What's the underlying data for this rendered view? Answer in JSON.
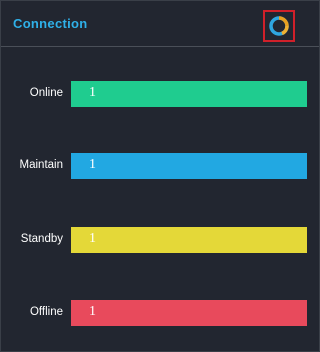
{
  "header": {
    "title": "Connection",
    "refresh_icon": "donut-refresh-icon",
    "refresh_colors": [
      "#2fa6e0",
      "#e8a020"
    ]
  },
  "rows": [
    {
      "label": "Online",
      "value": "1",
      "color": "#1fcc8f"
    },
    {
      "label": "Maintain",
      "value": "1",
      "color": "#22a8e2"
    },
    {
      "label": "Standby",
      "value": "1",
      "color": "#e4d838"
    },
    {
      "label": "Offline",
      "value": "1",
      "color": "#e84a5c"
    }
  ]
}
